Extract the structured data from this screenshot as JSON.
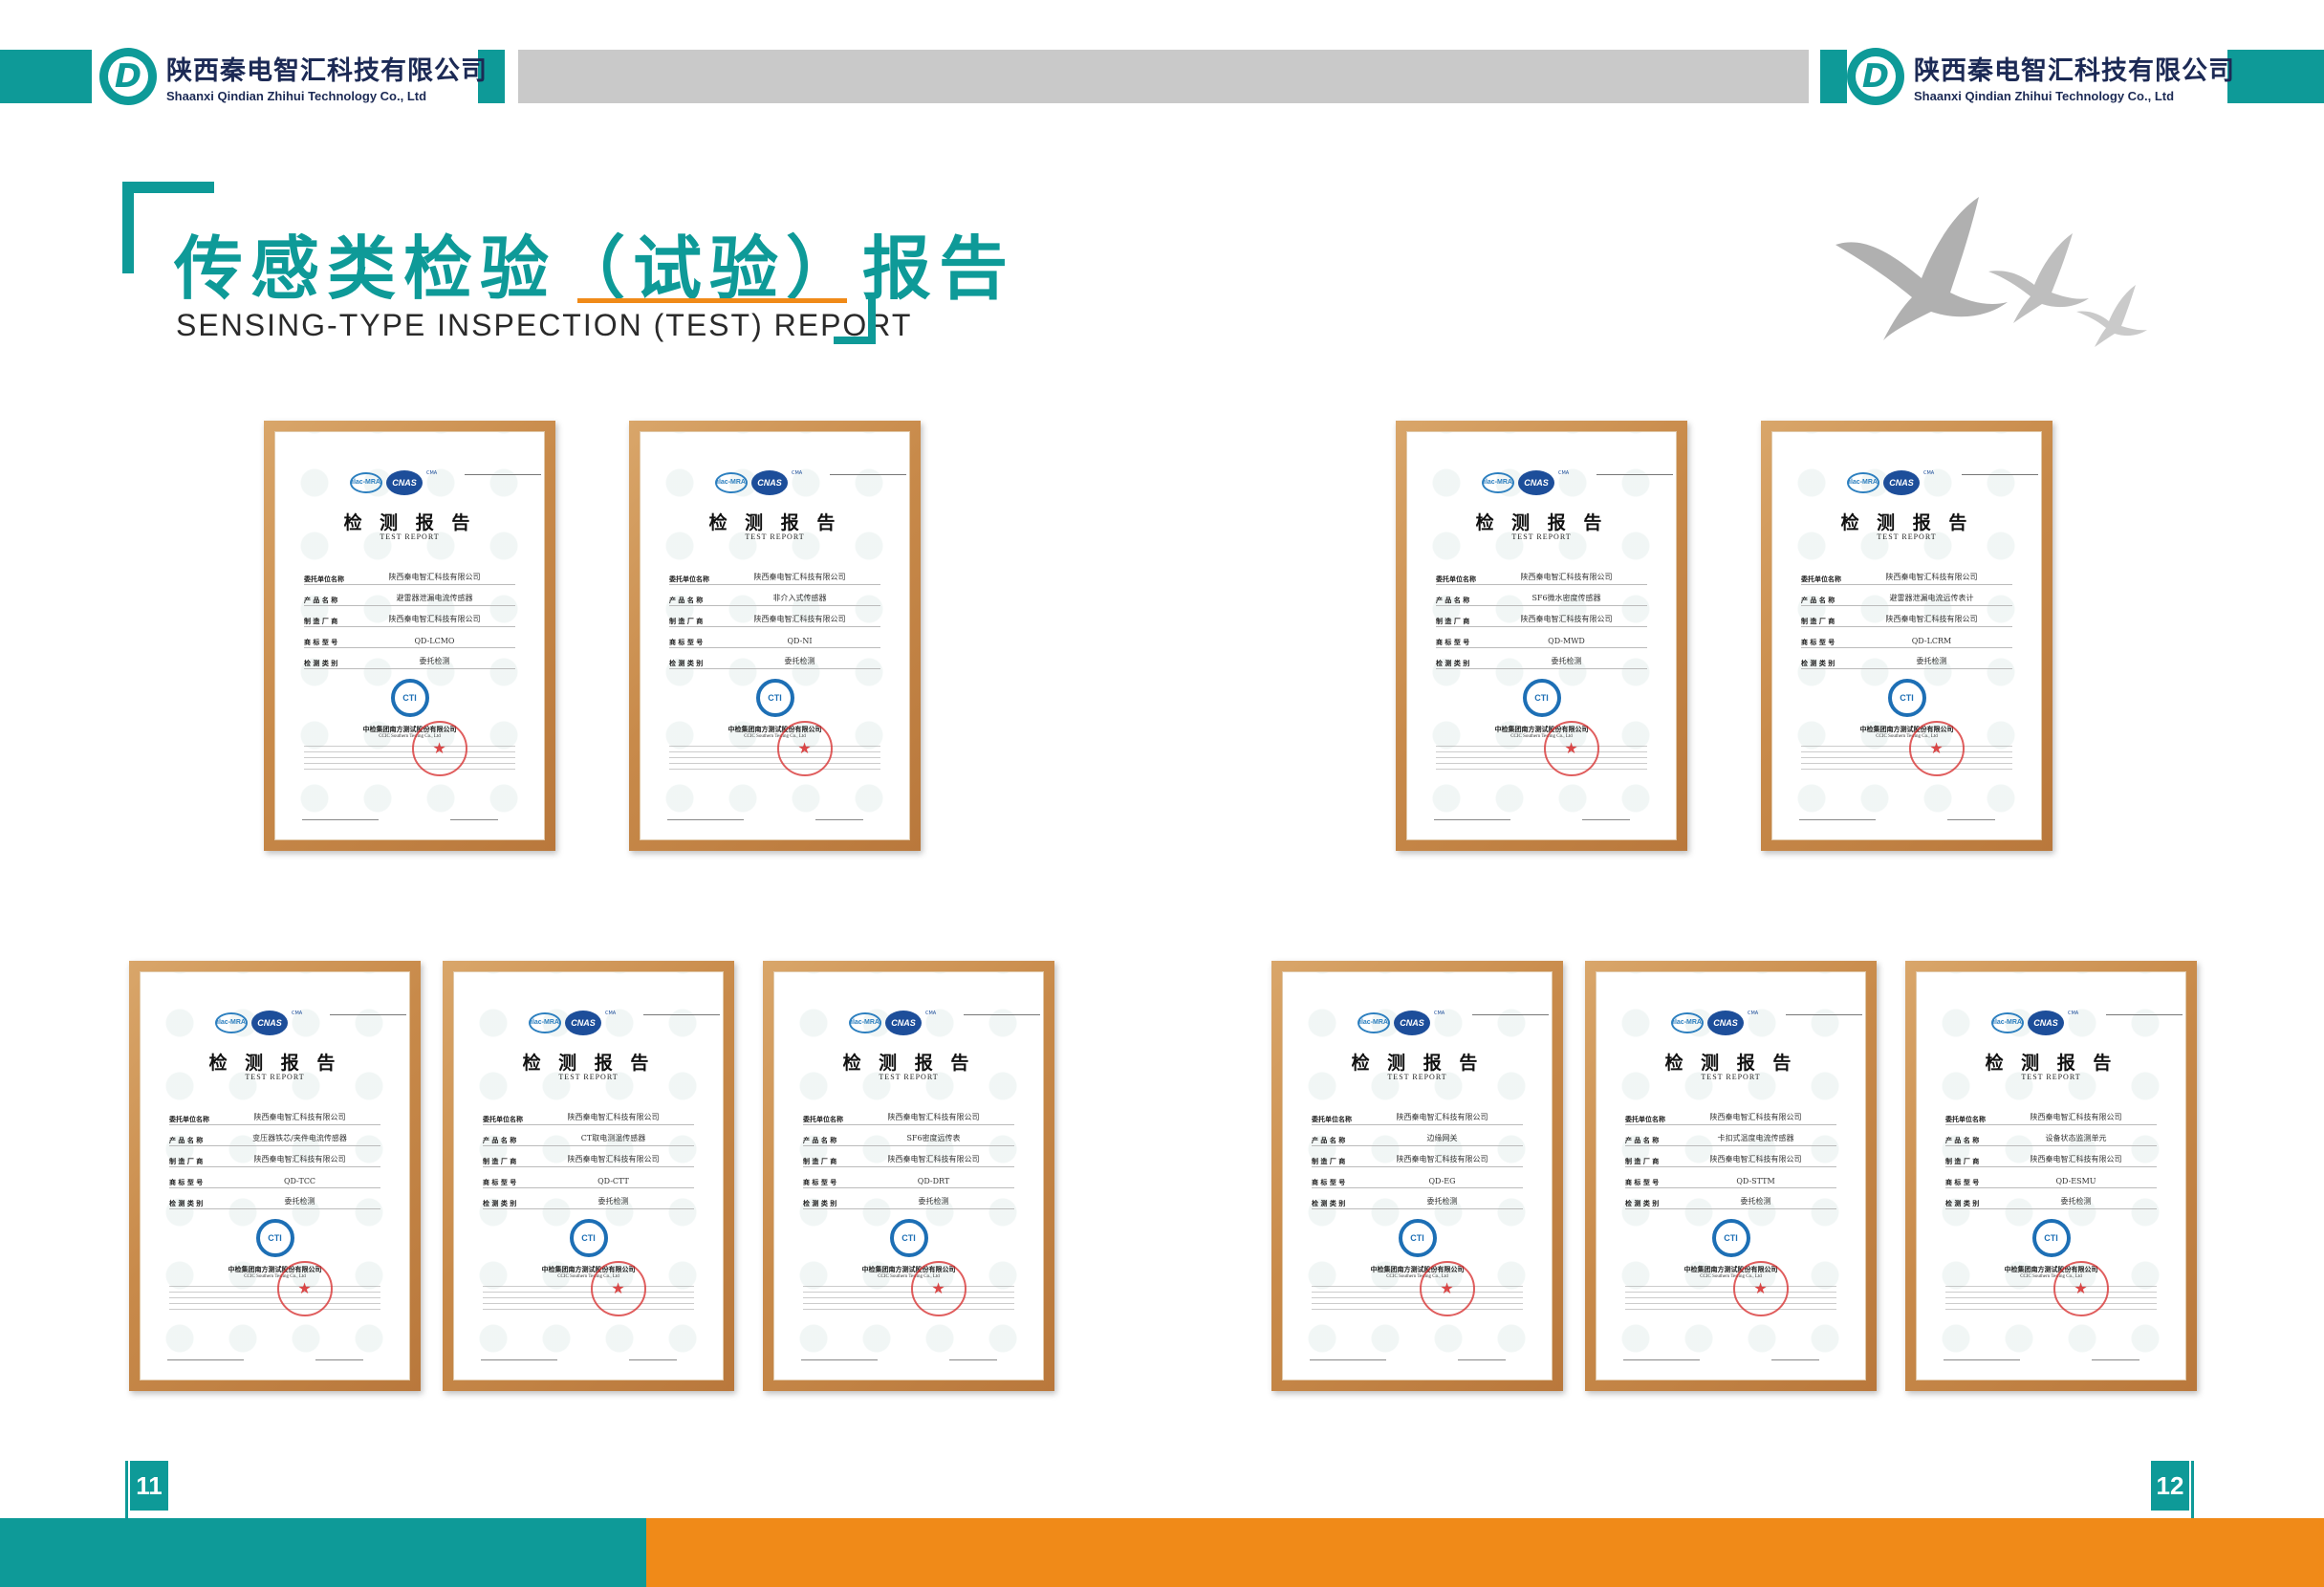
{
  "header": {
    "company_cn": "陕西秦电智汇科技有限公司",
    "company_en": "Shaanxi Qindian Zhihui Technology Co., Ltd"
  },
  "title": {
    "cn": "传感类检验（试验）报告",
    "en": "SENSING-TYPE INSPECTION (TEST) REPORT"
  },
  "certificate_common": {
    "title": "检 测 报 告",
    "subtitle": "TEST REPORT",
    "labels": {
      "client": "委托单位名称",
      "product": "产 品 名 称",
      "manufacturer": "制 造 厂 商",
      "model": "商 标 型 号",
      "test_type": "检 测 类 别"
    },
    "issuer": "中检集团南方测试股份有限公司",
    "issuer_en": "CCIC Southern Testing Co., Ltd",
    "badges": [
      "ilac-MRA",
      "CNAS",
      "CMA"
    ]
  },
  "certificates": [
    {
      "client": "陕西秦电智汇科技有限公司",
      "product": "避雷器泄漏电流传感器",
      "manufacturer": "陕西秦电智汇科技有限公司",
      "model": "QD-LCMO",
      "test_type": "委托检测"
    },
    {
      "client": "陕西秦电智汇科技有限公司",
      "product": "非介入式传感器",
      "manufacturer": "陕西秦电智汇科技有限公司",
      "model": "QD-NI",
      "test_type": "委托检测"
    },
    {
      "client": "陕西秦电智汇科技有限公司",
      "product": "SF6微水密度传感器",
      "manufacturer": "陕西秦电智汇科技有限公司",
      "model": "QD-MWD",
      "test_type": "委托检测"
    },
    {
      "client": "陕西秦电智汇科技有限公司",
      "product": "避雷器泄漏电流远传表计",
      "manufacturer": "陕西秦电智汇科技有限公司",
      "model": "QD-LCRM",
      "test_type": "委托检测"
    },
    {
      "client": "陕西秦电智汇科技有限公司",
      "product": "变压器铁芯/夹件电流传感器",
      "manufacturer": "陕西秦电智汇科技有限公司",
      "model": "QD-TCC",
      "test_type": "委托检测"
    },
    {
      "client": "陕西秦电智汇科技有限公司",
      "product": "CT取电测温传感器",
      "manufacturer": "陕西秦电智汇科技有限公司",
      "model": "QD-CTT",
      "test_type": "委托检测"
    },
    {
      "client": "陕西秦电智汇科技有限公司",
      "product": "SF6密度远传表",
      "manufacturer": "陕西秦电智汇科技有限公司",
      "model": "QD-DRT",
      "test_type": "委托检测"
    },
    {
      "client": "陕西秦电智汇科技有限公司",
      "product": "边缘网关",
      "manufacturer": "陕西秦电智汇科技有限公司",
      "model": "QD-EG",
      "test_type": "委托检测"
    },
    {
      "client": "陕西秦电智汇科技有限公司",
      "product": "卡扣式温度电流传感器",
      "manufacturer": "陕西秦电智汇科技有限公司",
      "model": "QD-STTM",
      "test_type": "委托检测"
    },
    {
      "client": "陕西秦电智汇科技有限公司",
      "product": "设备状态监测单元",
      "manufacturer": "陕西秦电智汇科技有限公司",
      "model": "QD-ESMU",
      "test_type": "委托检测"
    }
  ],
  "pages": {
    "left": "11",
    "right": "12"
  },
  "colors": {
    "teal": "#0e9a98",
    "orange": "#f08a18",
    "gray": "#c9c9c9",
    "navy": "#1c2a55"
  }
}
